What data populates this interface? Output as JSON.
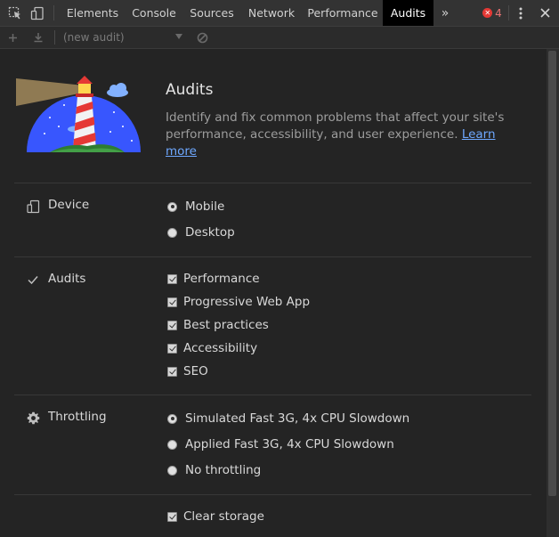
{
  "tabbar": {
    "tabs": [
      {
        "label": "Elements",
        "active": false
      },
      {
        "label": "Console",
        "active": false
      },
      {
        "label": "Sources",
        "active": false
      },
      {
        "label": "Network",
        "active": false
      },
      {
        "label": "Performance",
        "active": false
      },
      {
        "label": "Audits",
        "active": true
      }
    ],
    "error_count": "4"
  },
  "toolbar": {
    "audit_select_placeholder": "(new audit)"
  },
  "header": {
    "title": "Audits",
    "description": "Identify and fix common problems that affect your site's performance, accessibility, and user experience. ",
    "learn_more": "Learn more"
  },
  "device": {
    "label": "Device",
    "options": [
      {
        "label": "Mobile",
        "selected": true
      },
      {
        "label": "Desktop",
        "selected": false
      }
    ]
  },
  "audits": {
    "label": "Audits",
    "options": [
      {
        "label": "Performance",
        "checked": true
      },
      {
        "label": "Progressive Web App",
        "checked": true
      },
      {
        "label": "Best practices",
        "checked": true
      },
      {
        "label": "Accessibility",
        "checked": true
      },
      {
        "label": "SEO",
        "checked": true
      }
    ]
  },
  "throttling": {
    "label": "Throttling",
    "options": [
      {
        "label": "Simulated Fast 3G, 4x CPU Slowdown",
        "selected": true
      },
      {
        "label": "Applied Fast 3G, 4x CPU Slowdown",
        "selected": false
      },
      {
        "label": "No throttling",
        "selected": false
      }
    ]
  },
  "storage": {
    "label": "Clear storage",
    "checked": true
  },
  "colors": {
    "accent_link": "#6ea8ff",
    "error_badge": "#e53935",
    "background": "#242424"
  }
}
